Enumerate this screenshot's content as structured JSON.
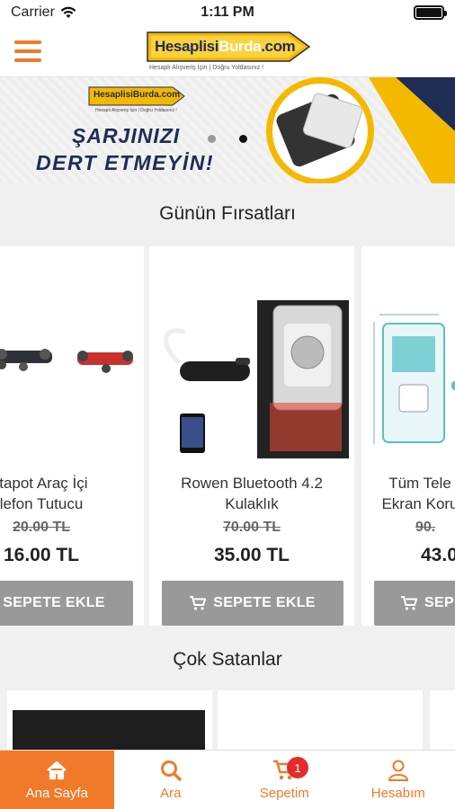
{
  "status_bar": {
    "carrier": "Carrier",
    "time": "1:11 PM",
    "battery_level": 1.0
  },
  "header": {
    "logo_text_main": "Hesaplisi",
    "logo_text_accent": "Burda",
    "logo_text_suffix": ".com",
    "logo_tagline": "Hesaplı Alışveriş İçin  |  Doğru Yoldasınız !",
    "brand_orange": "#f07a2a",
    "brand_yellow": "#f5b800",
    "brand_navy": "#1f2d55"
  },
  "banner": {
    "logo_text": "HesaplisiBurda.com",
    "tagline": "Hesaplı Alışveriş İçin | Doğru Yoldasınız !",
    "line1": "ŞARJINIZI",
    "line2": "DERT ETMEYİN!"
  },
  "deals": {
    "title": "Günün Fırsatları",
    "products": [
      {
        "name_line1": "ttapot Araç İçi",
        "name_line2": "lefon Tutucu",
        "old_price": "20.00 TL",
        "price": "16.00 TL",
        "button": "SEPETE EKLE"
      },
      {
        "name_line1": "Rowen Bluetooth 4.2",
        "name_line2": "Kulaklık",
        "old_price": "70.00 TL",
        "price": "35.00 TL",
        "button": "SEPETE EKLE"
      },
      {
        "name_line1": "Tüm Tele",
        "name_line2": "Ekran Koru",
        "old_price": "90.",
        "price": "43.0",
        "button": "SEPE"
      }
    ]
  },
  "best_sellers": {
    "title": "Çok Satanlar"
  },
  "tabbar": {
    "tabs": [
      {
        "label": "Ana Sayfa",
        "icon": "home-icon"
      },
      {
        "label": "Ara",
        "icon": "search-icon"
      },
      {
        "label": "Sepetim",
        "icon": "cart-icon"
      },
      {
        "label": "Hesabım",
        "icon": "user-icon"
      }
    ],
    "cart_count": "1"
  }
}
